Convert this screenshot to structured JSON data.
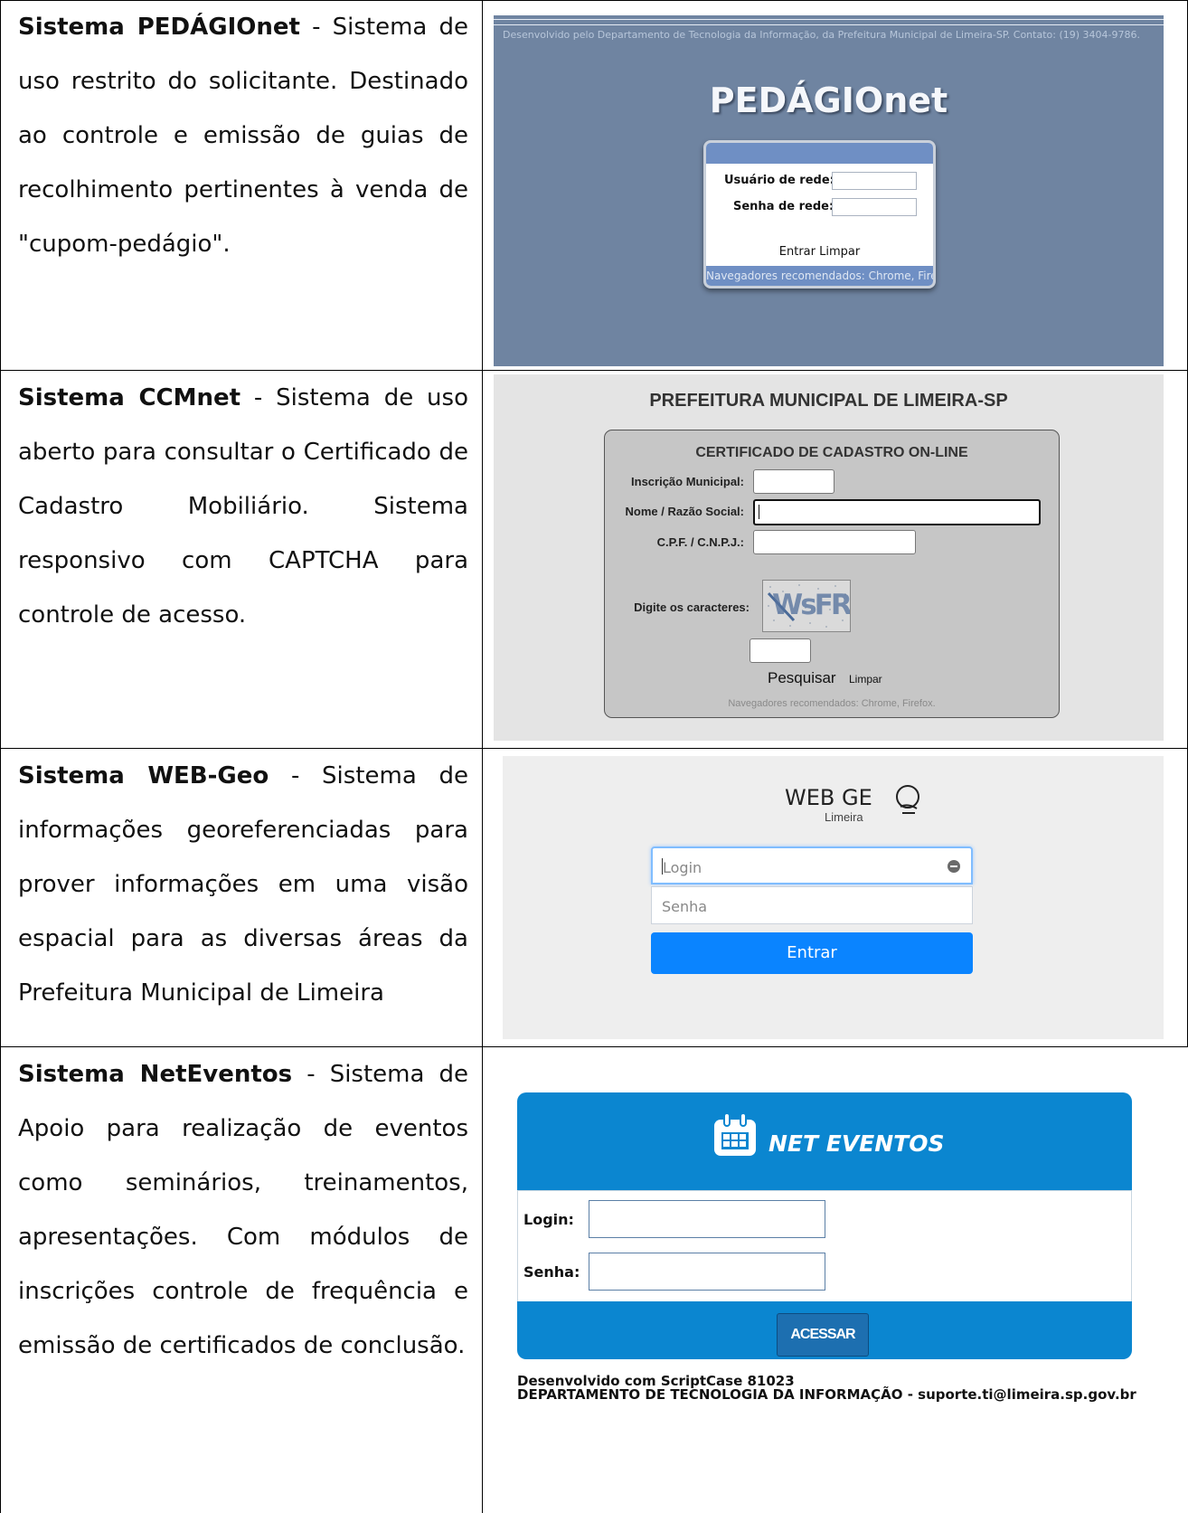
{
  "rows": [
    {
      "title": "Sistema PEDÁGIOnet",
      "text": " - Sistema de uso restrito do solicitante. Destinado ao controle e emissão de guias de recolhimento pertinentes à venda de \"cupom-pedágio\"."
    },
    {
      "title": "Sistema CCMnet",
      "text": " - Sistema de uso aberto para consultar o Certificado de Cadastro Mobiliário. Sistema responsivo com CAPTCHA para controle de acesso."
    },
    {
      "title": "Sistema WEB-Geo",
      "text": " - Sistema de informações georeferenciadas para prover informações em uma visão espacial para as diversas áreas da Prefeitura Municipal de Limeira"
    },
    {
      "title": "Sistema NetEventos",
      "text": " - Sistema de Apoio para realização de eventos como seminários, treinamentos, apresentações. Com módulos de inscrições controle de frequência e emissão de certificados de conclusão."
    }
  ],
  "pedagio": {
    "dev_text": "Desenvolvido pelo Departamento de Tecnologia da Informação, da Prefeitura Municipal de Limeira-SP. Contato: (19) 3404-9786.",
    "title": "PEDÁGIOnet",
    "user_label": "Usuário de rede:",
    "pass_label": "Senha de rede:",
    "enter": "Entrar",
    "clear": "Limpar",
    "browsers": "Navegadores recomendados: Chrome, Firefox."
  },
  "ccm": {
    "header": "PREFEITURA MUNICIPAL DE LIMEIRA-SP",
    "panel_title": "CERTIFICADO DE CADASTRO ON-LINE",
    "inscricao_label": "Inscrição Municipal:",
    "nome_label": "Nome / Razão Social:",
    "cpf_label": "C.P.F. / C.N.P.J.:",
    "captcha_label": "Digite os caracteres:",
    "captcha_text": "WsFR",
    "search": "Pesquisar",
    "clear": "Limpar",
    "browsers": "Navegadores recomendados: Chrome, Firefox."
  },
  "webgeo": {
    "logo": "WEB GE",
    "logo_sub": "Limeira",
    "login_placeholder": "Login",
    "password_placeholder": "Senha",
    "enter": "Entrar"
  },
  "neteventos": {
    "title": "NET EVENTOS",
    "login_label": "Login:",
    "pass_label": "Senha:",
    "button": "ACESSAR",
    "dev_line1": "Desenvolvido com ScriptCase 81023",
    "dev_line2": "DEPARTAMENTO DE TECNOLOGIA DA INFORMAÇÃO - suporte.ti@limeira.sp.gov.br"
  }
}
